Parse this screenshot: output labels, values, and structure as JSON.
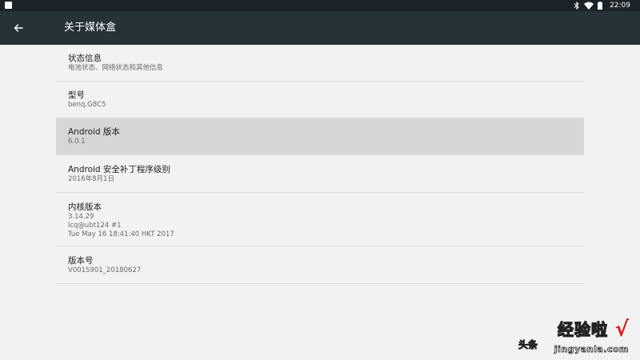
{
  "status_bar": {
    "time": "22:09",
    "icons": [
      "notification-square-icon",
      "bluetooth-icon",
      "wifi-icon",
      "battery-icon"
    ]
  },
  "app_bar": {
    "title": "关于媒体盒",
    "back_icon": "arrow-back-icon"
  },
  "items": [
    {
      "title": "状态信息",
      "subtitle_lines": [
        "电池状态、网络状态和其他信息"
      ]
    },
    {
      "title": "型号",
      "subtitle_lines": [
        "benq.G8C5"
      ]
    },
    {
      "title": "Android 版本",
      "subtitle_lines": [
        "6.0.1"
      ],
      "selected": true
    },
    {
      "title": "Android 安全补丁程序级别",
      "subtitle_lines": [
        "2016年8月1日"
      ]
    },
    {
      "title": "内核版本",
      "subtitle_lines": [
        "3.14.29",
        "lcq@ubt124 #1",
        "Tue May 16 18:41:40 HKT 2017"
      ]
    },
    {
      "title": "版本号",
      "subtitle_lines": [
        "V001S901_20180627"
      ]
    }
  ],
  "watermark": {
    "main": "经验啦",
    "check": "√",
    "url": "jingyanla.com",
    "side": "头条"
  },
  "colors": {
    "status_bar": "#1b2328",
    "app_bar": "#263238",
    "background": "#f2f2f2",
    "selected_row": "#d6d6d6",
    "divider": "#dcdcdc"
  }
}
